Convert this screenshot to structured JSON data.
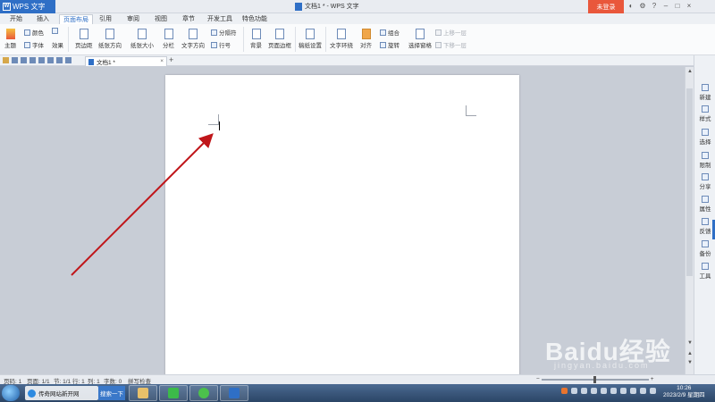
{
  "titlebar": {
    "app_name": "WPS 文字",
    "doc_title": "文档1 * - WPS 文字",
    "login_label": "未登录"
  },
  "menu_tabs": [
    "开始",
    "插入",
    "页面布局",
    "引用",
    "审阅",
    "视图",
    "章节",
    "开发工具",
    "特色功能"
  ],
  "active_tab": "页面布局",
  "ribbon": {
    "theme": "主题",
    "colors": "颜色",
    "font": "字体",
    "effects": "效果",
    "margins": "页边距",
    "orientation": "纸张方向",
    "size": "纸张大小",
    "columns": "分栏",
    "text_direction": "文字方向",
    "breaks": "分隔符",
    "line_numbers": "行号",
    "background": "背景",
    "page_border": "页面边框",
    "draft_paper": "稿纸设置",
    "wrap_text": "文字环绕",
    "align": "对齐",
    "rotate": "旋转",
    "group": "组合",
    "selection_pane": "选择窗格",
    "bring_forward": "上移一层",
    "send_backward": "下移一层"
  },
  "doc_tab": {
    "label": "文档1 *",
    "close": "×",
    "new_tab": "+"
  },
  "right_panel": [
    "新建",
    "样式",
    "选择",
    "限制",
    "分享",
    "属性",
    "反馈",
    "备份",
    "工具"
  ],
  "statusbar": {
    "page_no": "页码: 1",
    "pages": "页面: 1/1",
    "section": "节: 1/1",
    "row": "行: 1",
    "col": "列: 1",
    "word_count": "字数: 0",
    "spell_check": "拼写检查"
  },
  "taskbar": {
    "ie_label": "传奇网站新开网",
    "search_label": "搜索一下",
    "time": "10:26",
    "date": "2023/2/9 星期四"
  },
  "watermark": {
    "logo": "Baidu经验",
    "url": "jingyan.baidu.com"
  },
  "colors": {
    "accent": "#2f6fc6",
    "login": "#e9573b",
    "arrow": "#c0161a"
  }
}
